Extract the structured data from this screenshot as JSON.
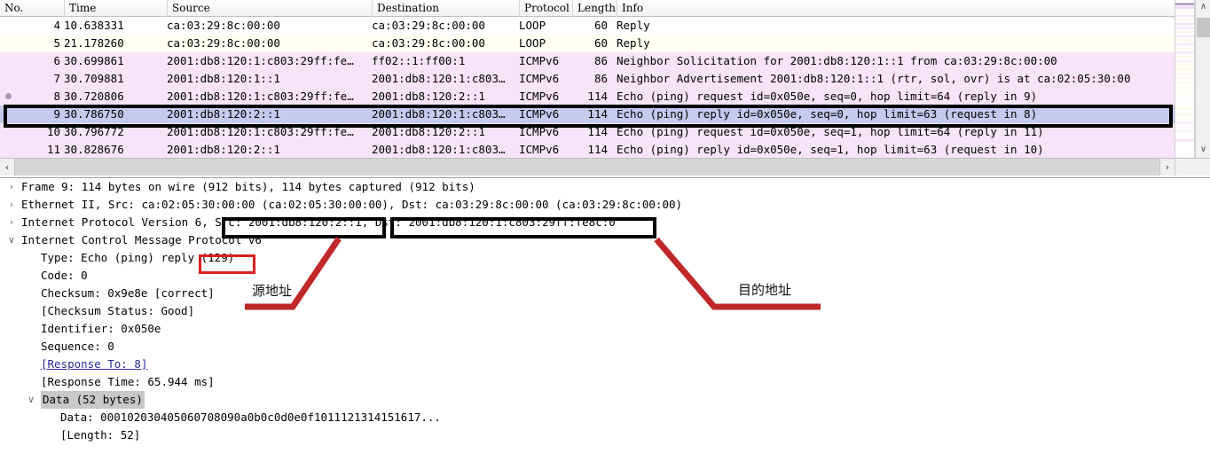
{
  "packet_list": {
    "columns": [
      {
        "label": "No."
      },
      {
        "label": "Time"
      },
      {
        "label": "Source"
      },
      {
        "label": "Destination"
      },
      {
        "label": "Protocol"
      },
      {
        "label": "Length"
      },
      {
        "label": "Info"
      }
    ],
    "rows": [
      {
        "no": "4",
        "time": "10.638331",
        "src": "ca:03:29:8c:00:00",
        "dst": "ca:03:29:8c:00:00",
        "proto": "LOOP",
        "len": "60",
        "info": "Reply",
        "bg": "#ffffff",
        "fg": "#000000",
        "marked": false,
        "selected": false
      },
      {
        "no": "5",
        "time": "21.178260",
        "src": "ca:03:29:8c:00:00",
        "dst": "ca:03:29:8c:00:00",
        "proto": "LOOP",
        "len": "60",
        "info": "Reply",
        "bg": "#fffff3",
        "fg": "#000000",
        "marked": false,
        "selected": false
      },
      {
        "no": "6",
        "time": "30.699861",
        "src": "2001:db8:120:1:c803:29ff:fe…",
        "dst": "ff02::1:ff00:1",
        "proto": "ICMPv6",
        "len": "86",
        "info": "Neighbor Solicitation for 2001:db8:120:1::1 from ca:03:29:8c:00:00",
        "bg": "#f7e4f8",
        "fg": "#000000",
        "marked": false,
        "selected": false
      },
      {
        "no": "7",
        "time": "30.709881",
        "src": "2001:db8:120:1::1",
        "dst": "2001:db8:120:1:c803…",
        "proto": "ICMPv6",
        "len": "86",
        "info": "Neighbor Advertisement 2001:db8:120:1::1 (rtr, sol, ovr) is at ca:02:05:30:00",
        "bg": "#f7e4f8",
        "fg": "#000000",
        "marked": false,
        "selected": false
      },
      {
        "no": "8",
        "time": "30.720806",
        "src": "2001:db8:120:1:c803:29ff:fe…",
        "dst": "2001:db8:120:2::1",
        "proto": "ICMPv6",
        "len": "114",
        "info": "Echo (ping) request id=0x050e, seq=0, hop limit=64 (reply in 9)",
        "bg": "#f7e4f8",
        "fg": "#000000",
        "marked": true,
        "selected": false
      },
      {
        "no": "9",
        "time": "30.786750",
        "src": "2001:db8:120:2::1",
        "dst": "2001:db8:120:1:c803…",
        "proto": "ICMPv6",
        "len": "114",
        "info": "Echo (ping) reply id=0x050e, seq=0, hop limit=63 (request in 8)",
        "bg": "#c5caef",
        "fg": "#000000",
        "marked": false,
        "selected": true
      },
      {
        "no": "10",
        "time": "30.796772",
        "src": "2001:db8:120:1:c803:29ff:fe…",
        "dst": "2001:db8:120:2::1",
        "proto": "ICMPv6",
        "len": "114",
        "info": "Echo (ping) request id=0x050e, seq=1, hop limit=64 (reply in 11)",
        "bg": "#f7e4f8",
        "fg": "#000000",
        "marked": false,
        "selected": false
      },
      {
        "no": "11",
        "time": "30.828676",
        "src": "2001:db8:120:2::1",
        "dst": "2001:db8:120:1:c803…",
        "proto": "ICMPv6",
        "len": "114",
        "info": "Echo (ping) reply id=0x050e, seq=1, hop limit=63 (request in 10)",
        "bg": "#f7e4f8",
        "fg": "#000000",
        "marked": false,
        "selected": false
      }
    ],
    "hscroll": {
      "left_arrow": "‹",
      "right_arrow": "›"
    },
    "vscroll": {
      "up_arrow": "∧",
      "down_arrow": "∨"
    }
  },
  "detail_tree": [
    {
      "indent": 0,
      "twisty": "collapsed",
      "text": "Frame 9: 114 bytes on wire (912 bits), 114 bytes captured (912 bits)",
      "style": "normal"
    },
    {
      "indent": 0,
      "twisty": "collapsed",
      "text": "Ethernet II, Src: ca:02:05:30:00:00 (ca:02:05:30:00:00), Dst: ca:03:29:8c:00:00 (ca:03:29:8c:00:00)",
      "style": "normal"
    },
    {
      "indent": 0,
      "twisty": "collapsed",
      "text": "Internet Protocol Version 6, Src: 2001:db8:120:2::1, Dst: 2001:db8:120:1:c803:29ff:fe8c:0",
      "style": "normal"
    },
    {
      "indent": 0,
      "twisty": "expanded",
      "text": "Internet Control Message Protocol v6",
      "style": "normal"
    },
    {
      "indent": 1,
      "twisty": "none",
      "text": "Type: Echo (ping) reply (129)",
      "style": "normal"
    },
    {
      "indent": 1,
      "twisty": "none",
      "text": "Code: 0",
      "style": "normal"
    },
    {
      "indent": 1,
      "twisty": "none",
      "text": "Checksum: 0x9e8e [correct]",
      "style": "normal"
    },
    {
      "indent": 1,
      "twisty": "none",
      "text": "[Checksum Status: Good]",
      "style": "normal"
    },
    {
      "indent": 1,
      "twisty": "none",
      "text": "Identifier: 0x050e",
      "style": "normal"
    },
    {
      "indent": 1,
      "twisty": "none",
      "text": "Sequence: 0",
      "style": "normal"
    },
    {
      "indent": 1,
      "twisty": "none",
      "text": "[Response To: 8]",
      "style": "link"
    },
    {
      "indent": 1,
      "twisty": "none",
      "text": "[Response Time: 65.944 ms]",
      "style": "normal"
    },
    {
      "indent": 1,
      "twisty": "expanded",
      "text": "Data (52 bytes)",
      "style": "selected"
    },
    {
      "indent": 2,
      "twisty": "none",
      "text": "Data: 000102030405060708090a0b0c0d0e0f1011121314151617...",
      "style": "normal"
    },
    {
      "indent": 2,
      "twisty": "none",
      "text": "[Length: 52]",
      "style": "normal"
    }
  ],
  "annotations": {
    "source_label": "源地址",
    "dest_label": "目的地址",
    "highlight_src_text": "Src: 2001:db8:120:2::1",
    "highlight_dst_text": "Dst: 2001:db8:120:1:c803:29ff:fe8c:0",
    "highlight_type_code": "(129)",
    "box_color_black": "#000000",
    "box_color_red": "#d81f1f",
    "arrow_color": "#c0282a"
  },
  "minimap_stripes": [
    {
      "color": "#ffffff",
      "h": 4
    },
    {
      "color": "#4a4a8a",
      "h": 1
    },
    {
      "color": "#f2e3f6",
      "h": 3
    },
    {
      "color": "#ede0f8",
      "h": 2
    },
    {
      "color": "#ffffff",
      "h": 2
    },
    {
      "color": "#fbf6e6",
      "h": 2
    },
    {
      "color": "#ffffff",
      "h": 3
    },
    {
      "color": "#f6e8f8",
      "h": 2
    },
    {
      "color": "#ffffff",
      "h": 2
    },
    {
      "color": "#fdf8ea",
      "h": 2
    },
    {
      "color": "#ffffff",
      "h": 3
    },
    {
      "color": "#f3e2f7",
      "h": 2
    },
    {
      "color": "#ffffff",
      "h": 2
    },
    {
      "color": "#f8eefa",
      "h": 3
    },
    {
      "color": "#ffffff",
      "h": 2
    },
    {
      "color": "#fcf7e8",
      "h": 2
    },
    {
      "color": "#ffffff",
      "h": 3
    },
    {
      "color": "#f4e6f8",
      "h": 2
    },
    {
      "color": "#ffffff",
      "h": 2
    },
    {
      "color": "#fdfaec",
      "h": 3
    },
    {
      "color": "#ffffff",
      "h": 2
    },
    {
      "color": "#f5e9f7",
      "h": 2
    },
    {
      "color": "#ffffff",
      "h": 3
    },
    {
      "color": "#fcf8e9",
      "h": 2
    },
    {
      "color": "#ffffff",
      "h": 2
    },
    {
      "color": "#f7ecf9",
      "h": 3
    },
    {
      "color": "#ffffff",
      "h": 2
    },
    {
      "color": "#fdfaee",
      "h": 2
    },
    {
      "color": "#ffffff",
      "h": 3
    },
    {
      "color": "#faf2f9",
      "h": 2
    },
    {
      "color": "#ffffff",
      "h": 2
    },
    {
      "color": "#fdfbf0",
      "h": 3
    },
    {
      "color": "#ffffff",
      "h": 2
    },
    {
      "color": "#fcf8ec",
      "h": 3
    },
    {
      "color": "#ffffff",
      "h": 2
    },
    {
      "color": "#fdfbf2",
      "h": 3
    },
    {
      "color": "#ffffff",
      "h": 2
    },
    {
      "color": "#fdfbf3",
      "h": 3
    },
    {
      "color": "#ffffff",
      "h": 2
    },
    {
      "color": "#fdfcf5",
      "h": 3
    },
    {
      "color": "#ffffff",
      "h": 2
    },
    {
      "color": "#fdfcf6",
      "h": 3
    },
    {
      "color": "#ffffff",
      "h": 2
    },
    {
      "color": "#fefdf8",
      "h": 3
    },
    {
      "color": "#ffffff",
      "h": 2
    },
    {
      "color": "#fefdfa",
      "h": 3
    },
    {
      "color": "#ffffff",
      "h": 4
    },
    {
      "color": "#fefefc",
      "h": 3
    },
    {
      "color": "#ffffff",
      "h": 4
    },
    {
      "color": "#fdf9f0",
      "h": 3
    },
    {
      "color": "#ffffff",
      "h": 4
    },
    {
      "color": "#fdfaf2",
      "h": 3
    },
    {
      "color": "#ffffff",
      "h": 6
    },
    {
      "color": "#f9eef6",
      "h": 3
    },
    {
      "color": "#ffffff",
      "h": 6
    },
    {
      "color": "#fbf3f8",
      "h": 3
    },
    {
      "color": "#ffffff",
      "h": 8
    },
    {
      "color": "#f6e9f5",
      "h": 3
    },
    {
      "color": "#ffffff",
      "h": 10
    }
  ]
}
